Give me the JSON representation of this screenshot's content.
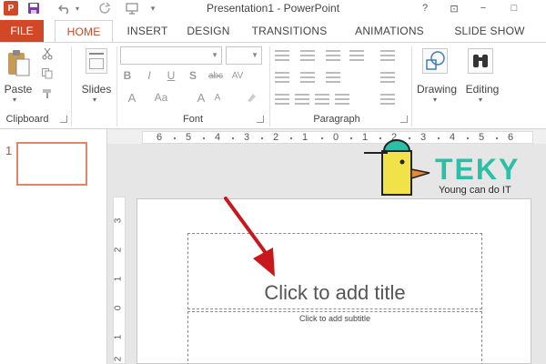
{
  "window": {
    "title": "Presentation1 - PowerPoint",
    "help": "?",
    "ribbon_display": "⊡",
    "minimize": "−",
    "restore": "□"
  },
  "quick_access": {
    "app_icon": "P",
    "save_icon": "save-icon",
    "undo_icon": "undo-icon",
    "redo_icon": "redo-icon",
    "start_from_beginning_icon": "slideshow-start-icon",
    "customize_icon": "customize-qat-icon"
  },
  "tabs": {
    "file": "FILE",
    "home": "HOME",
    "insert": "INSERT",
    "design": "DESIGN",
    "transitions": "TRANSITIONS",
    "animations": "ANIMATIONS",
    "slide_show": "SLIDE SHOW"
  },
  "ribbon": {
    "clipboard": {
      "label": "Clipboard",
      "paste": "Paste"
    },
    "slides": {
      "label": "Slides"
    },
    "font": {
      "label": "Font",
      "bold": "B",
      "italic": "I",
      "underline": "U",
      "shadow": "S",
      "strikethrough": "abc",
      "char_spacing": "AV",
      "increase_size": "A",
      "decrease_size": "A",
      "change_case": "Aa",
      "clear_formatting": "A"
    },
    "paragraph": {
      "label": "Paragraph"
    },
    "drawing": {
      "label": "Drawing"
    },
    "editing": {
      "label": "Editing"
    }
  },
  "slides_pane": {
    "slide_number": "1"
  },
  "ruler": {
    "horizontal": [
      "6",
      "5",
      "4",
      "3",
      "2",
      "1",
      "0",
      "1",
      "2",
      "3",
      "4",
      "5",
      "6"
    ],
    "vertical": [
      "3",
      "2",
      "1",
      "0",
      "1",
      "2"
    ]
  },
  "slide": {
    "title_placeholder": "Click to add title",
    "subtitle_placeholder": "Click to add subtitle"
  },
  "watermark": {
    "brand": "TEKY",
    "tagline": "Young can do IT"
  },
  "colors": {
    "accent": "#d24726",
    "thumbnail_border": "#e3846a",
    "arrow": "#c8181e",
    "brand_teal": "#2bbfa7",
    "mascot_yellow": "#f2e24a"
  }
}
